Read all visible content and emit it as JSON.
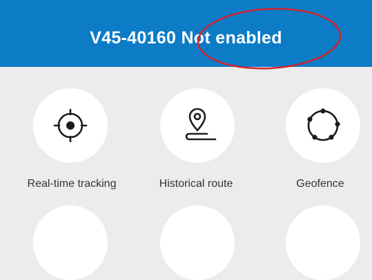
{
  "header": {
    "title": "V45-40160 Not enabled",
    "background_color": "#0d7cc6",
    "annotation_color": "#d4212b"
  },
  "features": [
    {
      "label": "Real-time tracking",
      "icon": "crosshair-icon"
    },
    {
      "label": "Historical route",
      "icon": "route-pin-icon"
    },
    {
      "label": "Geofence",
      "icon": "geofence-icon"
    }
  ]
}
